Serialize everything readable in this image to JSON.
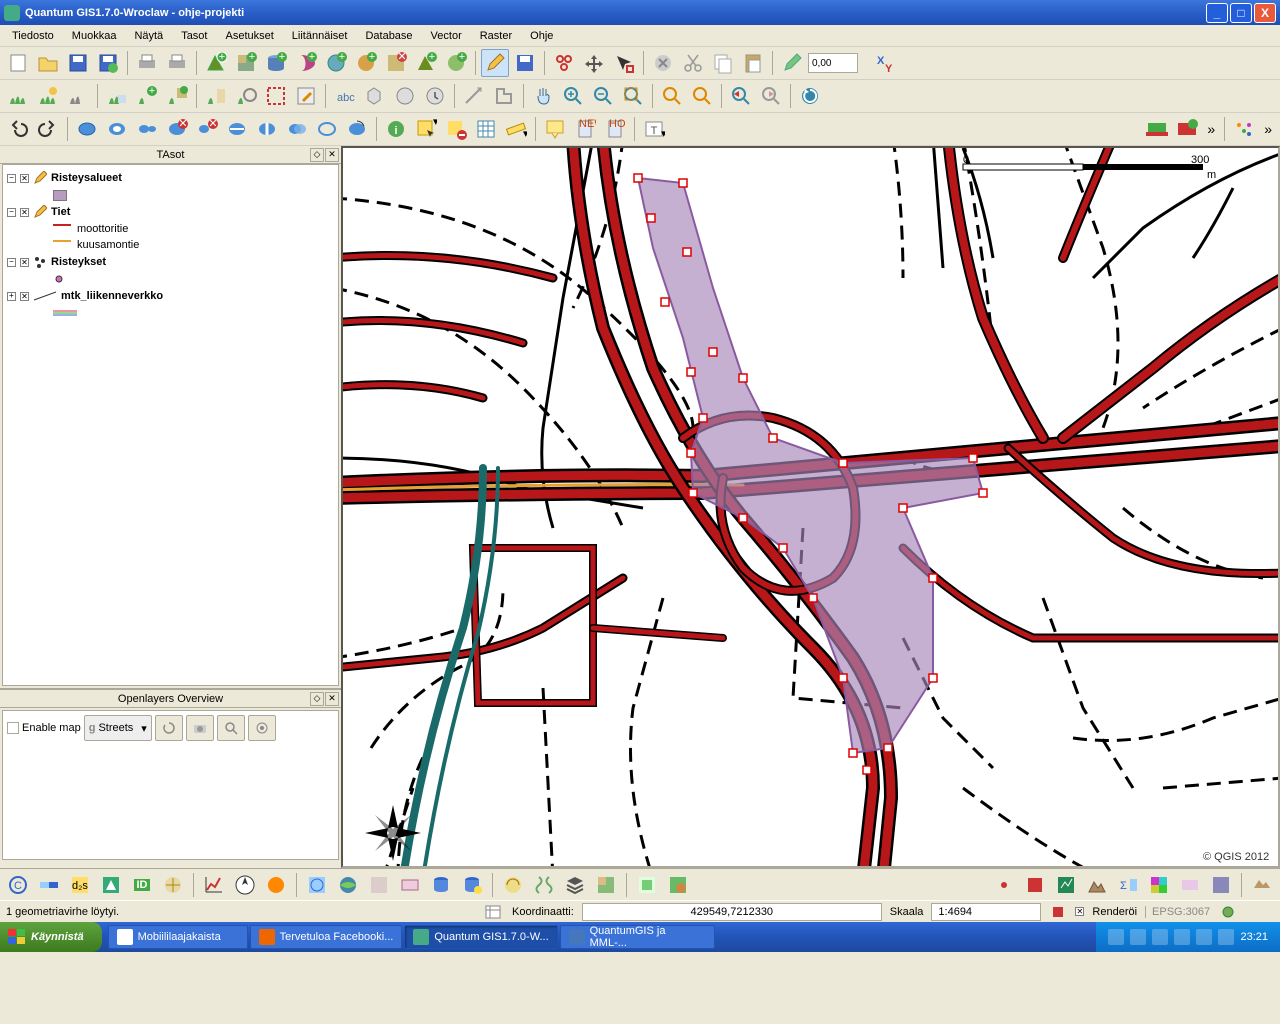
{
  "window": {
    "title": "Quantum GIS1.7.0-Wroclaw - ohje-projekti"
  },
  "menu": [
    "Tiedosto",
    "Muokkaa",
    "Näytä",
    "Tasot",
    "Asetukset",
    "Liitännäiset",
    "Database",
    "Vector",
    "Raster",
    "Ohje"
  ],
  "toolbar_coord_value": "0,00",
  "panels": {
    "layers_title": "TAsot",
    "openlayers_title": "Openlayers Overview",
    "enable_map_label": "Enable map",
    "streets_label": "Streets"
  },
  "layers": {
    "l1": {
      "name": "Risteysalueet"
    },
    "l2": {
      "name": "Tiet",
      "sub": [
        "moottoritie",
        "kuusamontie"
      ]
    },
    "l3": {
      "name": "Risteykset"
    },
    "l4": {
      "name": "mtk_liikenneverkko"
    }
  },
  "map": {
    "scalebar_left": "0",
    "scalebar_right": "300",
    "scalebar_unit": "m",
    "copyright": "© QGIS 2012"
  },
  "status": {
    "message": "1 geometriavirhe löytyi.",
    "coord_label": "Koordinaatti:",
    "coord_value": "429549,7212330",
    "scale_label": "Skaala",
    "scale_value": "1:4694",
    "render_label": "Renderöi",
    "epsg": "EPSG:3067"
  },
  "taskbar": {
    "start": "Käynnistä",
    "items": [
      "Mobiililaajakaista",
      "Tervetuloa Facebooki...",
      "Quantum GIS1.7.0-W...",
      "QuantumGIS ja MML-..."
    ],
    "time": "23:21"
  }
}
